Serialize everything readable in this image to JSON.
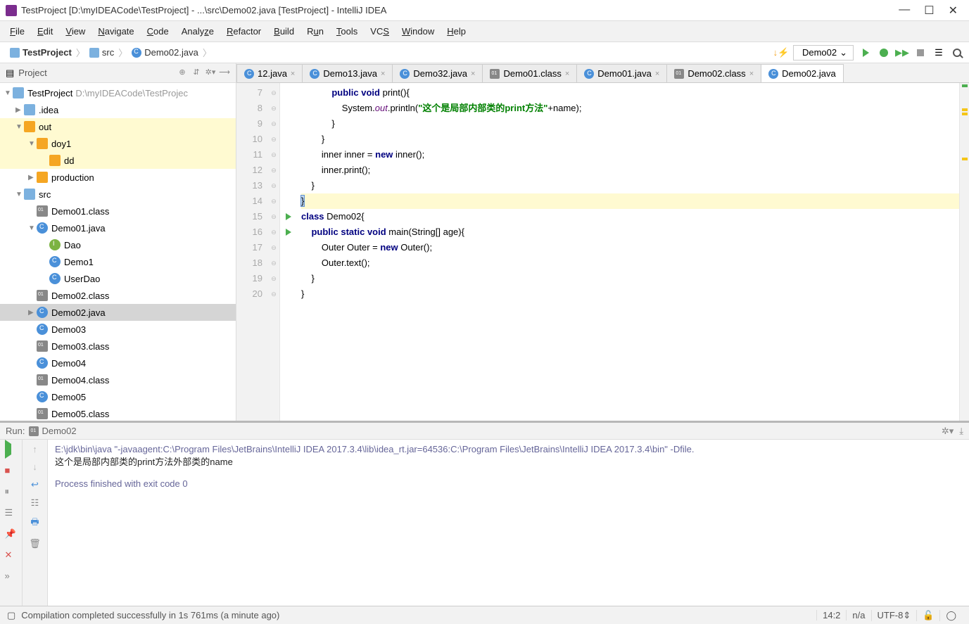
{
  "title": "TestProject [D:\\myIDEACode\\TestProject] - ...\\src\\Demo02.java [TestProject] - IntelliJ IDEA",
  "menu": [
    "File",
    "Edit",
    "View",
    "Navigate",
    "Code",
    "Analyze",
    "Refactor",
    "Build",
    "Run",
    "Tools",
    "VCS",
    "Window",
    "Help"
  ],
  "breadcrumb": {
    "proj": "TestProject",
    "src": "src",
    "file": "Demo02.java"
  },
  "runconfig": "Demo02",
  "project": {
    "label": "Project",
    "tree": [
      {
        "d": 0,
        "ar": "▼",
        "ico": "fold-b",
        "txt": "TestProject",
        "dim": "D:\\myIDEACode\\TestProjec"
      },
      {
        "d": 1,
        "ar": "▶",
        "ico": "fold-b",
        "txt": ".idea"
      },
      {
        "d": 1,
        "ar": "▼",
        "ico": "fold-o",
        "txt": "out",
        "hl": true
      },
      {
        "d": 2,
        "ar": "▼",
        "ico": "fold-o",
        "txt": "doy1",
        "hl": true
      },
      {
        "d": 3,
        "ar": "",
        "ico": "fold-o",
        "txt": "dd",
        "hl": true
      },
      {
        "d": 2,
        "ar": "▶",
        "ico": "fold-o",
        "txt": "production"
      },
      {
        "d": 1,
        "ar": "▼",
        "ico": "fold-b",
        "txt": "src"
      },
      {
        "d": 2,
        "ar": "",
        "ico": "cls-01",
        "txt": "Demo01.class"
      },
      {
        "d": 2,
        "ar": "▼",
        "ico": "java-c",
        "txt": "Demo01.java"
      },
      {
        "d": 3,
        "ar": "",
        "ico": "iface",
        "txt": "Dao"
      },
      {
        "d": 3,
        "ar": "",
        "ico": "java-c",
        "txt": "Demo1"
      },
      {
        "d": 3,
        "ar": "",
        "ico": "java-c",
        "txt": "UserDao"
      },
      {
        "d": 2,
        "ar": "",
        "ico": "cls-01",
        "txt": "Demo02.class"
      },
      {
        "d": 2,
        "ar": "▶",
        "ico": "java-c",
        "txt": "Demo02.java",
        "sel": true
      },
      {
        "d": 2,
        "ar": "",
        "ico": "java-c",
        "txt": "Demo03"
      },
      {
        "d": 2,
        "ar": "",
        "ico": "cls-01",
        "txt": "Demo03.class"
      },
      {
        "d": 2,
        "ar": "",
        "ico": "java-c",
        "txt": "Demo04"
      },
      {
        "d": 2,
        "ar": "",
        "ico": "cls-01",
        "txt": "Demo04.class"
      },
      {
        "d": 2,
        "ar": "",
        "ico": "java-c",
        "txt": "Demo05"
      },
      {
        "d": 2,
        "ar": "",
        "ico": "cls-01",
        "txt": "Demo05.class"
      }
    ]
  },
  "tabs": [
    {
      "label": "12.java",
      "ico": "java-c"
    },
    {
      "label": "Demo13.java",
      "ico": "java-c"
    },
    {
      "label": "Demo32.java",
      "ico": "java-c"
    },
    {
      "label": "Demo01.class",
      "ico": "cls-01"
    },
    {
      "label": "Demo01.java",
      "ico": "java-c"
    },
    {
      "label": "Demo02.class",
      "ico": "cls-01"
    },
    {
      "label": "Demo02.java",
      "ico": "java-c",
      "active": true,
      "pinned": true
    }
  ],
  "lines": {
    "start": 7,
    "end": 20,
    "code": [
      {
        "n": 7,
        "html": "            <span class='kw'>public</span> <span class='kw'>void</span> print(){"
      },
      {
        "n": 8,
        "html": "                System.<span class='stat'>out</span>.println(<span class='str'>\"这个是局部内部类的print方法\"</span>+name);"
      },
      {
        "n": 9,
        "html": "            }"
      },
      {
        "n": 10,
        "html": "        }"
      },
      {
        "n": 11,
        "html": "        inner inner = <span class='kw'>new</span> inner();"
      },
      {
        "n": 12,
        "html": "        inner.print();"
      },
      {
        "n": 13,
        "html": "    }"
      },
      {
        "n": 14,
        "html": "<span class='caretbox'>}</span>",
        "hl": true
      },
      {
        "n": 15,
        "html": "<span class='kw'>class</span> Demo02{",
        "run": true
      },
      {
        "n": 16,
        "html": "    <span class='kw'>public</span> <span class='kw'>static</span> <span class='kw'>void</span> main(String[] age){",
        "run": true
      },
      {
        "n": 17,
        "html": "        Outer Outer = <span class='kw'>new</span> Outer();"
      },
      {
        "n": 18,
        "html": "        Outer.text();"
      },
      {
        "n": 19,
        "html": "    }"
      },
      {
        "n": 20,
        "html": "}"
      }
    ]
  },
  "run": {
    "title": "Run:",
    "tab": "Demo02",
    "cmd": "E:\\jdk\\bin\\java \"-javaagent:C:\\Program Files\\JetBrains\\IntelliJ IDEA 2017.3.4\\lib\\idea_rt.jar=64536:C:\\Program Files\\JetBrains\\IntelliJ IDEA 2017.3.4\\bin\" -Dfile.",
    "out": "这个是局部内部类的print方法外部类的name",
    "exit": "Process finished with exit code 0"
  },
  "status": {
    "msg": "Compilation completed successfully in 1s 761ms (a minute ago)",
    "pos": "14:2",
    "ins": "n/a",
    "enc": "UTF-8"
  }
}
